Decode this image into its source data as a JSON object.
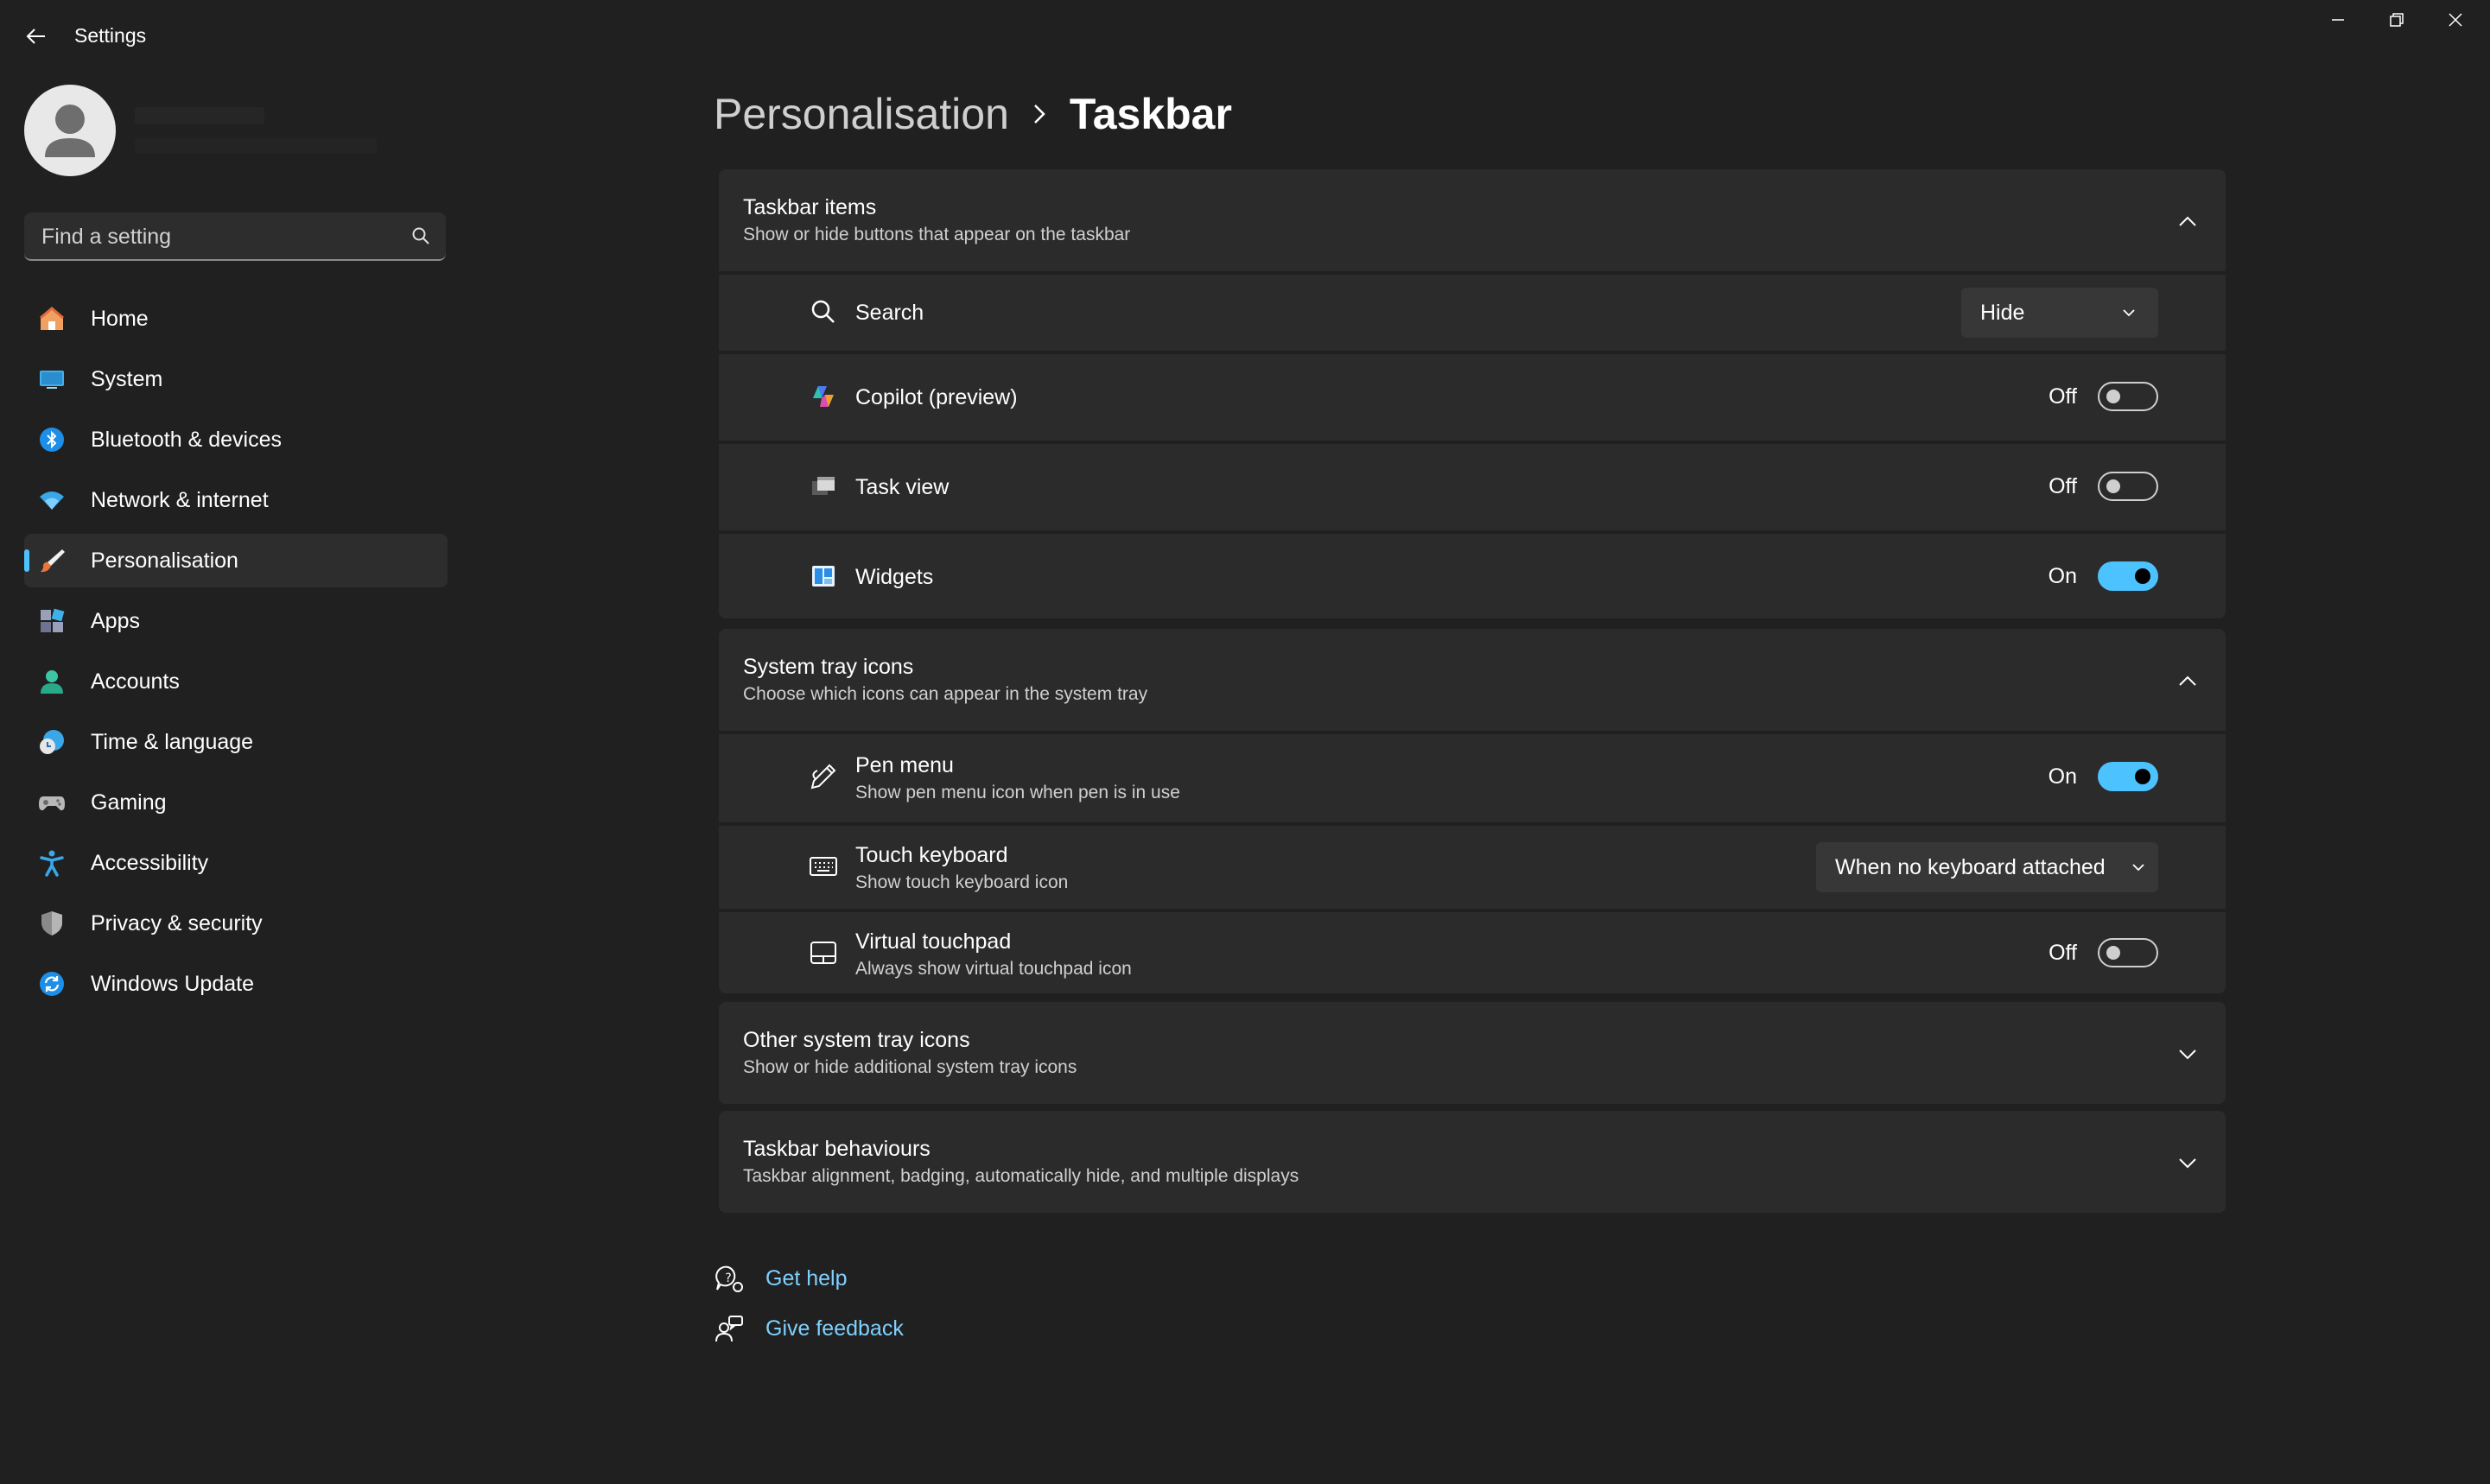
{
  "window": {
    "title": "Settings"
  },
  "sidebar": {
    "search_placeholder": "Find a setting",
    "items": [
      {
        "label": "Home",
        "icon": "home-icon"
      },
      {
        "label": "System",
        "icon": "monitor-icon"
      },
      {
        "label": "Bluetooth & devices",
        "icon": "bluetooth-icon"
      },
      {
        "label": "Network & internet",
        "icon": "wifi-icon"
      },
      {
        "label": "Personalisation",
        "icon": "brush-icon",
        "active": true
      },
      {
        "label": "Apps",
        "icon": "apps-icon"
      },
      {
        "label": "Accounts",
        "icon": "person-icon"
      },
      {
        "label": "Time & language",
        "icon": "globe-clock-icon"
      },
      {
        "label": "Gaming",
        "icon": "gamepad-icon"
      },
      {
        "label": "Accessibility",
        "icon": "accessibility-icon"
      },
      {
        "label": "Privacy & security",
        "icon": "shield-icon"
      },
      {
        "label": "Windows Update",
        "icon": "update-icon"
      }
    ]
  },
  "breadcrumb": {
    "parent": "Personalisation",
    "current": "Taskbar"
  },
  "taskbar_items": {
    "title": "Taskbar items",
    "subtitle": "Show or hide buttons that appear on the taskbar",
    "search": {
      "label": "Search",
      "value": "Hide"
    },
    "copilot": {
      "label": "Copilot (preview)",
      "state": "Off"
    },
    "taskview": {
      "label": "Task view",
      "state": "Off"
    },
    "widgets": {
      "label": "Widgets",
      "state": "On"
    }
  },
  "system_tray": {
    "title": "System tray icons",
    "subtitle": "Choose which icons can appear in the system tray",
    "pen": {
      "label": "Pen menu",
      "sub": "Show pen menu icon when pen is in use",
      "state": "On"
    },
    "touch_keyboard": {
      "label": "Touch keyboard",
      "sub": "Show touch keyboard icon",
      "value": "When no keyboard attached"
    },
    "touchpad": {
      "label": "Virtual touchpad",
      "sub": "Always show virtual touchpad icon",
      "state": "Off"
    }
  },
  "other_tray": {
    "title": "Other system tray icons",
    "subtitle": "Show or hide additional system tray icons"
  },
  "behaviours": {
    "title": "Taskbar behaviours",
    "subtitle": "Taskbar alignment, badging, automatically hide, and multiple displays"
  },
  "help": {
    "get_help": "Get help",
    "give_feedback": "Give feedback"
  },
  "colors": {
    "background": "#202020",
    "card": "#2b2b2b",
    "accent": "#4cc2ff",
    "link": "#7fd0ff"
  }
}
